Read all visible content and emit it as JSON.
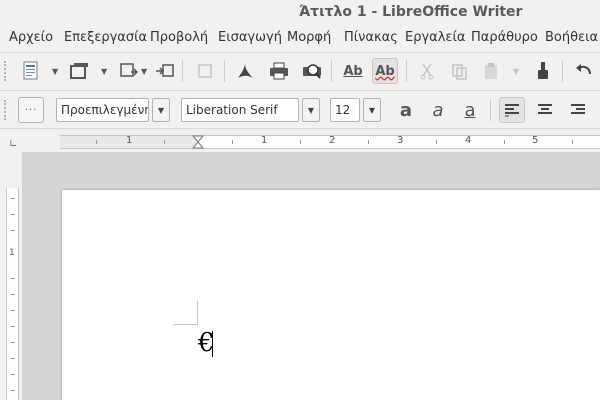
{
  "window": {
    "title": "Άτιτλο 1 - LibreOffice Writer"
  },
  "menubar": {
    "items": [
      {
        "label": "Αρχείο"
      },
      {
        "label": "Επεξεργασία"
      },
      {
        "label": "Προβολή"
      },
      {
        "label": "Εισαγωγή"
      },
      {
        "label": "Μορφή"
      },
      {
        "label": "Πίνακας"
      },
      {
        "label": "Εργαλεία"
      },
      {
        "label": "Παράθυρο"
      },
      {
        "label": "Βοήθεια"
      }
    ]
  },
  "standard_toolbar": {
    "spelling_label": "Ab",
    "autospell_label": "Ab"
  },
  "formatting_toolbar": {
    "paragraph_style": "Προεπιλεγμένη",
    "font_name": "Liberation Serif",
    "font_size": "12",
    "bold_glyph": "a",
    "italic_glyph": "a",
    "underline_glyph": "a"
  },
  "ruler": {
    "numbers": [
      "1",
      "1",
      "2",
      "3",
      "4",
      "5"
    ],
    "vertical_numbers": [
      "1"
    ]
  },
  "document": {
    "text": "€"
  },
  "colors": {
    "background": "#f2f1f0",
    "page": "#ffffff",
    "workspace": "#d7d6d4"
  }
}
